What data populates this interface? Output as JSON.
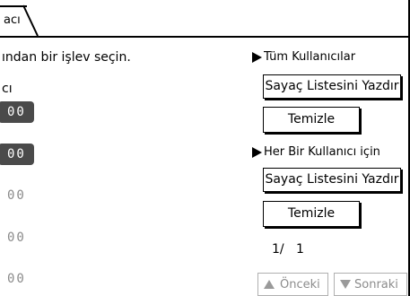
{
  "tab": {
    "label": "acı"
  },
  "left": {
    "instruction": "ından bir işlev seçin.",
    "column_caption": "cı",
    "counters": [
      "00",
      "00",
      "00",
      "00",
      "00"
    ]
  },
  "all_users": {
    "header": "Tüm Kullanıcılar",
    "print_button": "Sayaç Listesini Yazdır",
    "clear_button": "Temizle"
  },
  "per_user": {
    "header": "Her Bir Kullanıcı için",
    "print_button": "Sayaç Listesini Yazdır",
    "clear_button": "Temizle"
  },
  "pagination": {
    "current": "1/",
    "total": "1",
    "prev_label": "Önceki",
    "next_label": "Sonraki"
  }
}
